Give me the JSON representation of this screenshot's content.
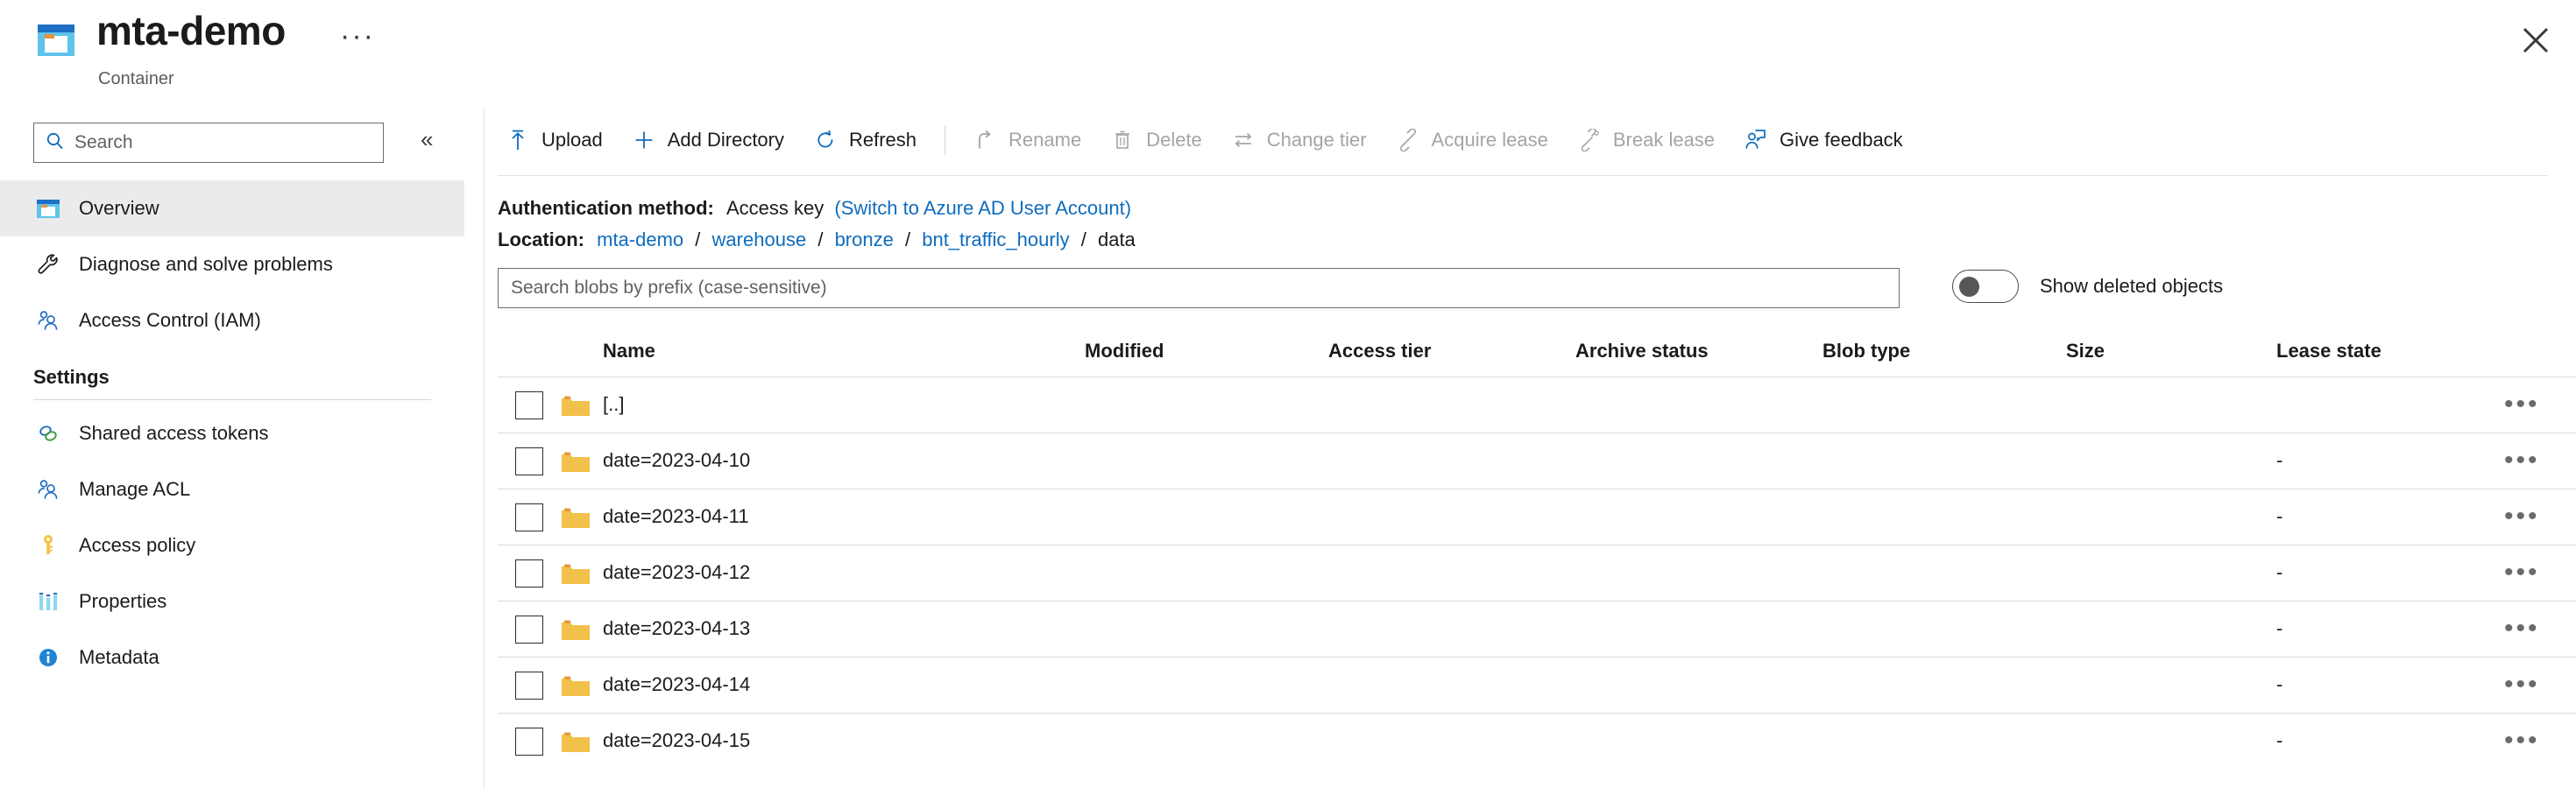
{
  "header": {
    "title": "mta-demo",
    "subtitle": "Container",
    "more_label": "···",
    "close_label": "✕",
    "icon": "container-icon"
  },
  "sidebar": {
    "search": {
      "placeholder": "Search",
      "value": "",
      "icon": "search-icon"
    },
    "collapse_label": "«",
    "items": [
      {
        "label": "Overview",
        "icon": "overview-window-icon",
        "selected": true
      },
      {
        "label": "Diagnose and solve problems",
        "icon": "wrench-icon",
        "selected": false
      },
      {
        "label": "Access Control (IAM)",
        "icon": "people-icon",
        "selected": false
      }
    ],
    "settings_heading": "Settings",
    "settings_items": [
      {
        "label": "Shared access tokens",
        "icon": "link-rings-icon"
      },
      {
        "label": "Manage ACL",
        "icon": "people-icon"
      },
      {
        "label": "Access policy",
        "icon": "key-icon"
      },
      {
        "label": "Properties",
        "icon": "bars-icon"
      },
      {
        "label": "Metadata",
        "icon": "info-icon"
      }
    ]
  },
  "toolbar": {
    "buttons": [
      {
        "label": "Upload",
        "icon": "upload-arrow-icon",
        "disabled": false
      },
      {
        "label": "Add Directory",
        "icon": "plus-icon",
        "disabled": false
      },
      {
        "label": "Refresh",
        "icon": "refresh-icon",
        "disabled": false
      },
      {
        "label": "Rename",
        "icon": "rename-arrow-icon",
        "disabled": true
      },
      {
        "label": "Delete",
        "icon": "trash-icon",
        "disabled": true
      },
      {
        "label": "Change tier",
        "icon": "swap-arrows-icon",
        "disabled": true
      },
      {
        "label": "Acquire lease",
        "icon": "plug-icon",
        "disabled": true
      },
      {
        "label": "Break lease",
        "icon": "broken-plug-icon",
        "disabled": true
      },
      {
        "label": "Give feedback",
        "icon": "feedback-person-icon",
        "disabled": false
      }
    ]
  },
  "info": {
    "auth_label": "Authentication method:",
    "auth_value": "Access key",
    "auth_switch_link": "(Switch to Azure AD User Account)",
    "location_label": "Location:",
    "breadcrumb": [
      {
        "text": "mta-demo",
        "link": true
      },
      {
        "text": "warehouse",
        "link": true
      },
      {
        "text": "bronze",
        "link": true
      },
      {
        "text": "bnt_traffic_hourly",
        "link": true
      },
      {
        "text": "data",
        "link": false
      }
    ],
    "breadcrumb_separator": "/"
  },
  "filter": {
    "search_placeholder": "Search blobs by prefix (case-sensitive)",
    "search_value": "",
    "toggle_label": "Show deleted objects",
    "toggle_on": false
  },
  "table": {
    "columns": [
      "Name",
      "Modified",
      "Access tier",
      "Archive status",
      "Blob type",
      "Size",
      "Lease state"
    ],
    "row_menu_label": "•••",
    "rows": [
      {
        "name": "[..]",
        "icon": "folder-icon",
        "modified": "",
        "access_tier": "",
        "archive_status": "",
        "blob_type": "",
        "size": "",
        "lease_state": "",
        "checked": false
      },
      {
        "name": "date=2023-04-10",
        "icon": "folder-icon",
        "modified": "",
        "access_tier": "",
        "archive_status": "",
        "blob_type": "",
        "size": "",
        "lease_state": "-",
        "checked": false
      },
      {
        "name": "date=2023-04-11",
        "icon": "folder-icon",
        "modified": "",
        "access_tier": "",
        "archive_status": "",
        "blob_type": "",
        "size": "",
        "lease_state": "-",
        "checked": false
      },
      {
        "name": "date=2023-04-12",
        "icon": "folder-icon",
        "modified": "",
        "access_tier": "",
        "archive_status": "",
        "blob_type": "",
        "size": "",
        "lease_state": "-",
        "checked": false
      },
      {
        "name": "date=2023-04-13",
        "icon": "folder-icon",
        "modified": "",
        "access_tier": "",
        "archive_status": "",
        "blob_type": "",
        "size": "",
        "lease_state": "-",
        "checked": false
      },
      {
        "name": "date=2023-04-14",
        "icon": "folder-icon",
        "modified": "",
        "access_tier": "",
        "archive_status": "",
        "blob_type": "",
        "size": "",
        "lease_state": "-",
        "checked": false
      },
      {
        "name": "date=2023-04-15",
        "icon": "folder-icon",
        "modified": "",
        "access_tier": "",
        "archive_status": "",
        "blob_type": "",
        "size": "",
        "lease_state": "-",
        "checked": false
      }
    ]
  },
  "colors": {
    "link": "#0f6cbd",
    "accent": "#0078d4",
    "folder": "#f2c14b",
    "selected_bg": "#ebebeb",
    "disabled_text": "#a4a4a4"
  }
}
